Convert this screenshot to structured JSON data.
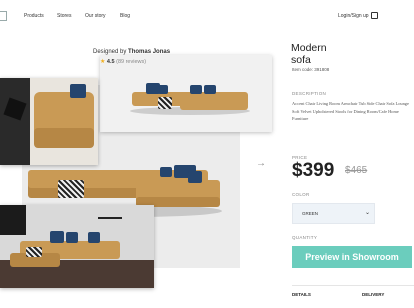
{
  "nav": {
    "items": [
      "Products",
      "Stores",
      "Our story",
      "Blog"
    ],
    "login": "Login/Sign up"
  },
  "gallery": {
    "designed_prefix": "Designed by",
    "designer": "Thomas Jonas",
    "rating": "4.5",
    "reviews": "(89 reviews)"
  },
  "product": {
    "title_line1": "Modern",
    "title_line2": "sofa",
    "code": "Item code: 391808",
    "description_label": "DESCRIPTION",
    "description": "Accent Chair Living Room Armchair Tub Side Chair Sofa Lounge Soft Velvet Upholstered Stools for Dining Room/Cafe Home Furniture",
    "price_label": "PRICE",
    "price": "$399",
    "old_price": "$465",
    "color_label": "COLOR",
    "color_value": "GREEN",
    "quantity_label": "QUANTITY",
    "cta": "Preview in Showroom",
    "tabs": [
      "DETAILS",
      "DELIVERY"
    ]
  },
  "colors": {
    "accent": "#6bcdbd",
    "sofa": "#c99a55",
    "pillow": "#25456e"
  }
}
